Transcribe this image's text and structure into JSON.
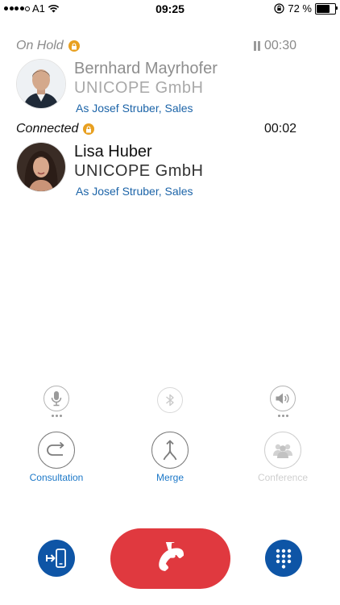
{
  "status_bar": {
    "carrier": "A1",
    "time": "09:25",
    "battery_percent": "72 %",
    "battery_level": 0.72,
    "signal_bars": 4
  },
  "calls": [
    {
      "state": "On Hold",
      "timer": "00:30",
      "name": "Bernhard Mayrhofer",
      "company": "UNICOPE GmbH",
      "as_identity": "As Josef Struber, Sales",
      "held": true
    },
    {
      "state": "Connected",
      "timer": "00:02",
      "name": "Lisa Huber",
      "company": "UNICOPE GmbH",
      "as_identity": "As Josef Struber, Sales",
      "held": false
    }
  ],
  "actions": {
    "consultation": "Consultation",
    "merge": "Merge",
    "conference": "Conference"
  },
  "colors": {
    "accent_blue": "#1c78c8",
    "bottom_button_blue": "#0e55a6",
    "hangup_red": "#e0393f",
    "lock_orange": "#e8a020"
  },
  "icons": {
    "mute": "microphone-icon",
    "bluetooth": "bluetooth-icon",
    "speaker": "speaker-icon",
    "consultation": "consultation-icon",
    "merge": "merge-icon",
    "conference": "conference-icon",
    "transfer": "transfer-to-phone-icon",
    "hangup": "phone-hangup-icon",
    "keypad": "keypad-icon"
  }
}
